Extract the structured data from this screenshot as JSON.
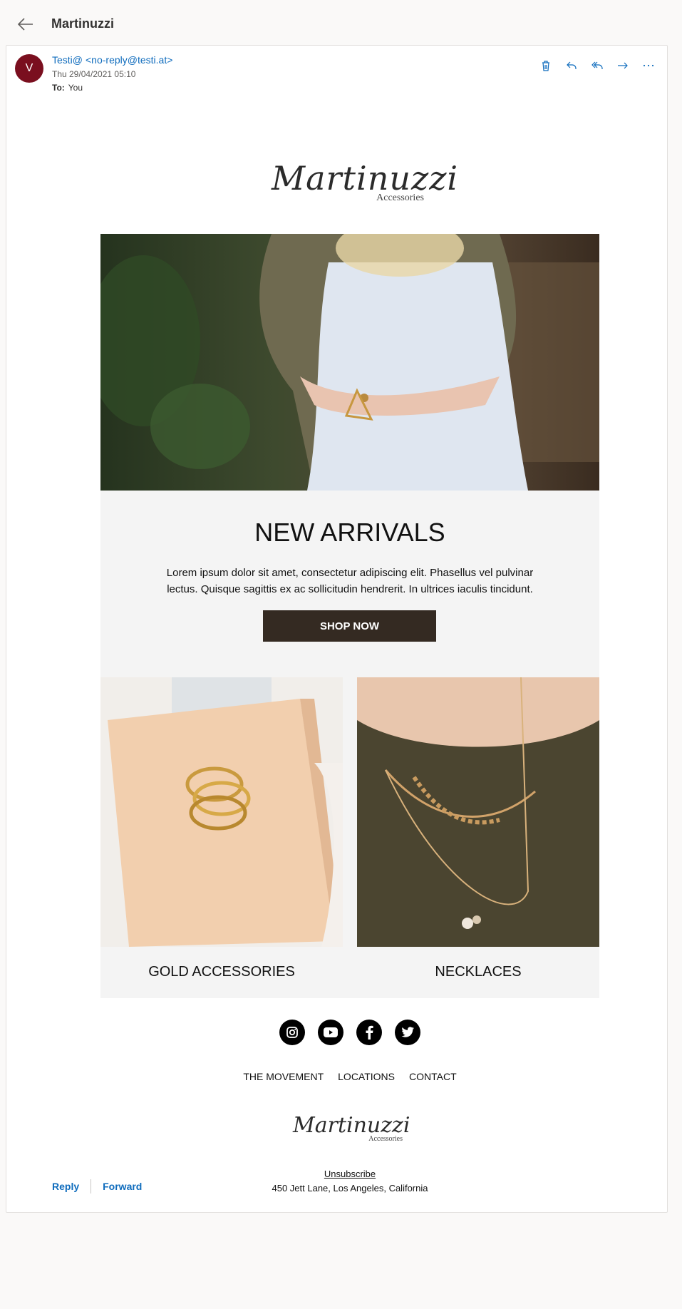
{
  "header": {
    "title": "Martinuzzi"
  },
  "message": {
    "avatar_initial": "V",
    "sender_name": "Testi@",
    "sender_address": "<no-reply@testi.at>",
    "date": "Thu 29/04/2021 05:10",
    "to_label": "To:",
    "to_value": "You"
  },
  "toolbar": {
    "delete_icon": "trash-icon",
    "reply_icon": "reply-icon",
    "reply_all_icon": "reply-all-icon",
    "forward_icon": "forward-icon",
    "more_icon": "more-icon",
    "accent": "#0f6cbd"
  },
  "email": {
    "logo_name": "Martinuzzi",
    "logo_sub": "Accessories",
    "hero_heading": "NEW ARRIVALS",
    "hero_text": "Lorem ipsum dolor sit amet, consectetur adipiscing elit. Phasellus vel pulvinar lectus. Quisque sagittis ex ac sollicitudin hendrerit. In ultrices iaculis tincidunt.",
    "cta_label": "SHOP NOW",
    "products": [
      {
        "label": "GOLD ACCESSORIES"
      },
      {
        "label": "NECKLACES"
      }
    ],
    "social": [
      "instagram-icon",
      "youtube-icon",
      "facebook-icon",
      "twitter-icon"
    ],
    "footer_links": [
      "THE MOVEMENT",
      "LOCATIONS",
      "CONTACT"
    ],
    "unsubscribe": "Unsubscribe",
    "address": "450 Jett Lane, Los Angeles, California"
  },
  "actions": {
    "reply": "Reply",
    "forward": "Forward"
  }
}
